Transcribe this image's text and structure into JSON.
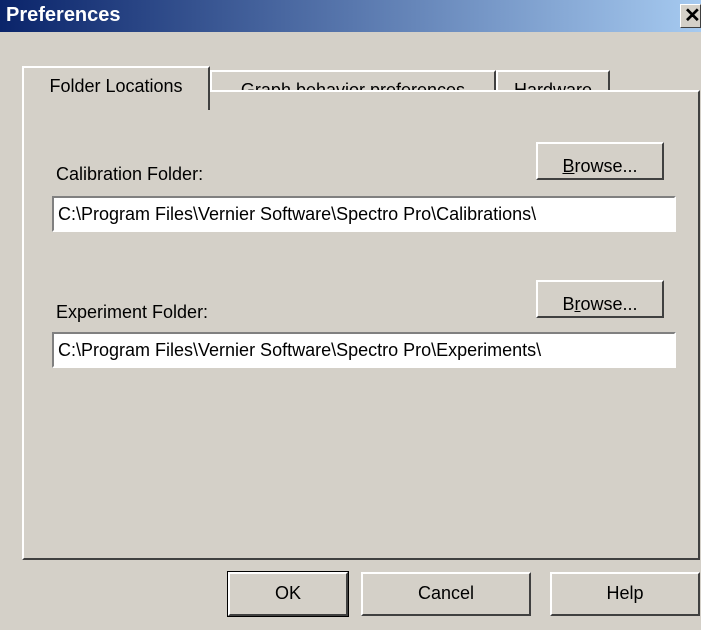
{
  "window": {
    "title": "Preferences",
    "close_glyph": "✕"
  },
  "tabs": [
    {
      "label": "Folder Locations",
      "active": true
    },
    {
      "label": "Graph behavior preferences",
      "active": false
    },
    {
      "label": "Hardware",
      "active": false
    }
  ],
  "calibration": {
    "label": "Calibration Folder:",
    "value": "C:\\Program Files\\Vernier Software\\Spectro Pro\\Calibrations\\",
    "browse_pre": "",
    "browse_u": "B",
    "browse_post": "rowse..."
  },
  "experiment": {
    "label": "Experiment Folder:",
    "value": "C:\\Program Files\\Vernier Software\\Spectro Pro\\Experiments\\",
    "browse_pre": "B",
    "browse_u": "r",
    "browse_post": "owse..."
  },
  "buttons": {
    "ok": "OK",
    "cancel": "Cancel",
    "help": "Help"
  }
}
